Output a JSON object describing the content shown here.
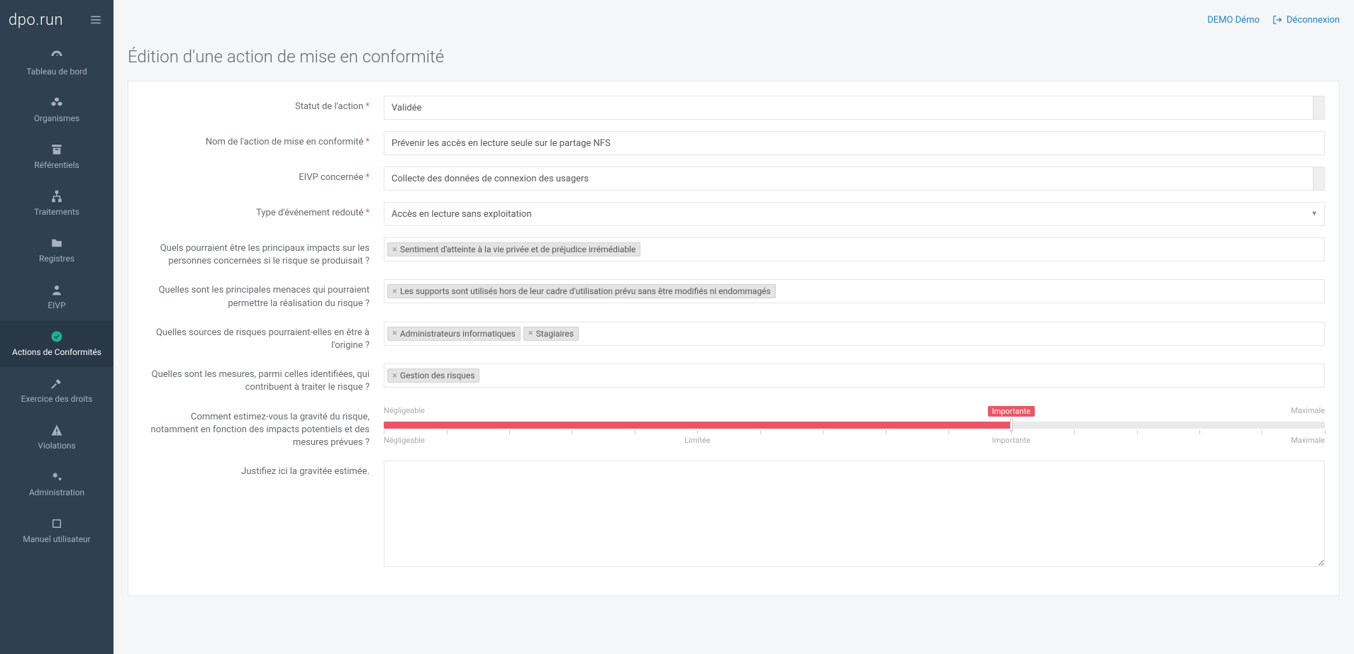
{
  "brand": "dpo.run",
  "topbar": {
    "user": "DEMO Démo",
    "logout": "Déconnexion"
  },
  "sidebar": {
    "items": [
      {
        "icon": "dashboard",
        "label": "Tableau de bord"
      },
      {
        "icon": "cubes",
        "label": "Organismes"
      },
      {
        "icon": "archive",
        "label": "Référentiels"
      },
      {
        "icon": "sitemap",
        "label": "Traitements"
      },
      {
        "icon": "folder",
        "label": "Registres"
      },
      {
        "icon": "user",
        "label": "EIVP"
      },
      {
        "icon": "check-circle",
        "label": "Actions de Conformités"
      },
      {
        "icon": "gavel",
        "label": "Exercice des droits"
      },
      {
        "icon": "warning",
        "label": "Violations"
      },
      {
        "icon": "cogs",
        "label": "Administration"
      },
      {
        "icon": "book",
        "label": "Manuel utilisateur"
      }
    ]
  },
  "page": {
    "title": "Édition d'une action de mise en conformité"
  },
  "form": {
    "status": {
      "label": "Statut de l'action",
      "value": "Validée"
    },
    "name": {
      "label": "Nom de l'action de mise en conformité",
      "value": "Prévenir les accès en lecture seule sur le partage NFS"
    },
    "eivp": {
      "label": "EIVP concernée",
      "value": "Collecte des données de connexion des usagers"
    },
    "event_type": {
      "label": "Type d'événement redouté",
      "value": "Accès en lecture sans exploitation"
    },
    "impacts": {
      "label": "Quels pourraient être les principaux impacts sur les personnes concernées si le risque se produisait ?",
      "tags": [
        "Sentiment d'atteinte à la vie privée et de préjudice irrémédiable"
      ]
    },
    "threats": {
      "label": "Quelles sont les principales menaces qui pourraient permettre la réalisation du risque ?",
      "tags": [
        "Les supports sont utilisés hors de leur cadre d'utilisation prévu sans être modifiés ni endommagés"
      ]
    },
    "sources": {
      "label": "Quelles sources de risques pourraient-elles en être à l'origine ?",
      "tags": [
        "Administrateurs informatiques",
        "Stagiaires"
      ]
    },
    "measures": {
      "label": "Quelles sont les mesures, parmi celles identifiées, qui contribuent à traiter le risque ?",
      "tags": [
        "Gestion des risques"
      ]
    },
    "severity": {
      "label": "Comment estimez-vous la gravité du risque, notamment en fonction des impacts potentiels et des mesures prévues ?",
      "min_label": "Négligeable",
      "max_label": "Maximale",
      "value_label": "Importante",
      "marks": [
        "Négligeable",
        "Limitée",
        "Importante",
        "Maximale"
      ],
      "value_percent": 66.67
    },
    "justify": {
      "label": "Justifiez ici la gravitée estimée.",
      "value": ""
    }
  }
}
